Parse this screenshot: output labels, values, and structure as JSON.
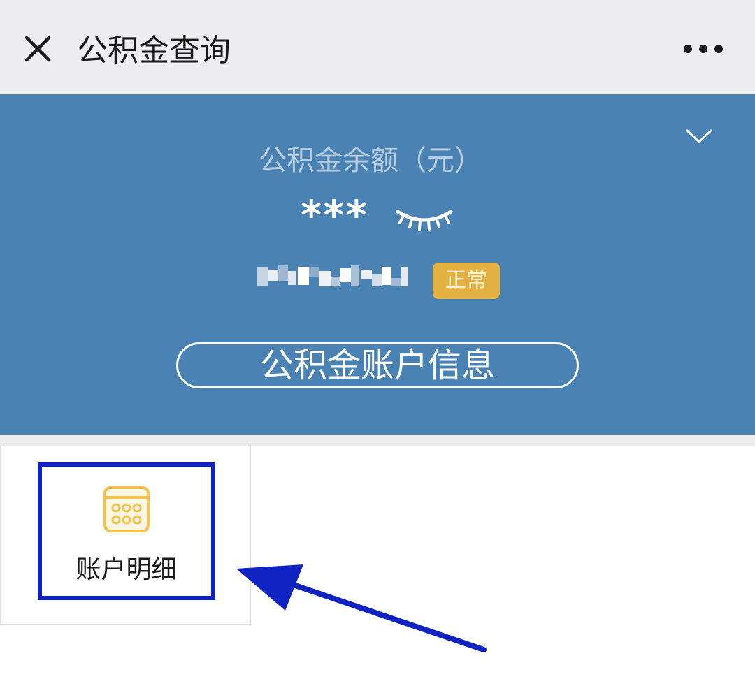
{
  "header": {
    "title": "公积金查询",
    "close_icon": "close-icon",
    "more_icon": "more-dots-icon"
  },
  "account_card": {
    "balance_label": "公积金余额（元）",
    "balance_masked": "***",
    "visibility_icon": "eye-closed-icon",
    "expand_icon": "chevron-down-icon",
    "account_number_visibility": "blurred",
    "status": "正常",
    "info_button_label": "公积金账户信息"
  },
  "services": [
    {
      "label": "账户明细",
      "icon": "calendar-icon"
    }
  ],
  "annotation": {
    "highlight_target": "账户明细",
    "highlight_color": "#0f22c2"
  },
  "colors": {
    "header_bg": "#ededf0",
    "banner_bg": "#4a82b4",
    "status_badge_bg": "#e2b142",
    "icon_accent": "#f2c24e"
  }
}
